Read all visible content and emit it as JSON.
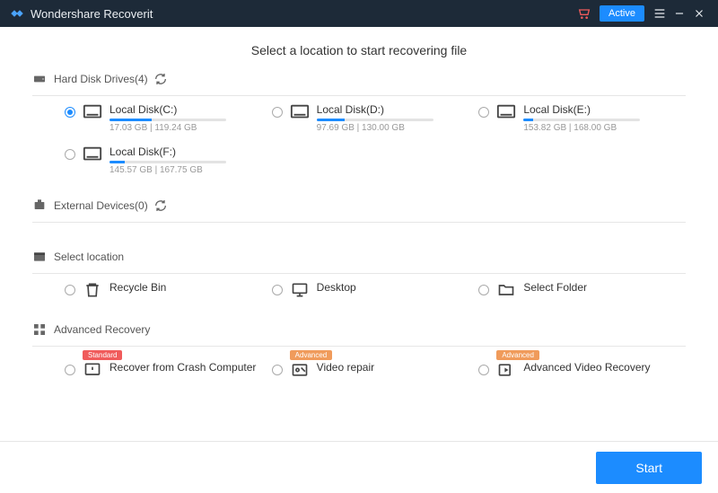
{
  "app": {
    "title": "Wondershare Recoverit",
    "active_button": "Active"
  },
  "page_title": "Select a location to start recovering file",
  "sections": {
    "hdd": {
      "label": "Hard Disk Drives(4)"
    },
    "ext": {
      "label": "External Devices(0)"
    },
    "loc": {
      "label": "Select location"
    },
    "adv": {
      "label": "Advanced Recovery"
    }
  },
  "disks": [
    {
      "label": "Local Disk(C:)",
      "size": "17.03 GB | 119.24 GB",
      "pct": 36,
      "selected": true
    },
    {
      "label": "Local Disk(D:)",
      "size": "97.69 GB | 130.00 GB",
      "pct": 24,
      "selected": false
    },
    {
      "label": "Local Disk(E:)",
      "size": "153.82 GB | 168.00 GB",
      "pct": 8,
      "selected": false
    },
    {
      "label": "Local Disk(F:)",
      "size": "145.57 GB | 167.75 GB",
      "pct": 13,
      "selected": false
    }
  ],
  "locations": [
    {
      "label": "Recycle Bin"
    },
    {
      "label": "Desktop"
    },
    {
      "label": "Select Folder"
    }
  ],
  "advanced": [
    {
      "label": "Recover from Crash Computer",
      "tag": "Standard",
      "tag_class": "std"
    },
    {
      "label": "Video repair",
      "tag": "Advanced",
      "tag_class": "adv"
    },
    {
      "label": "Advanced Video Recovery",
      "tag": "Advanced",
      "tag_class": "adv"
    }
  ],
  "footer": {
    "start": "Start"
  }
}
